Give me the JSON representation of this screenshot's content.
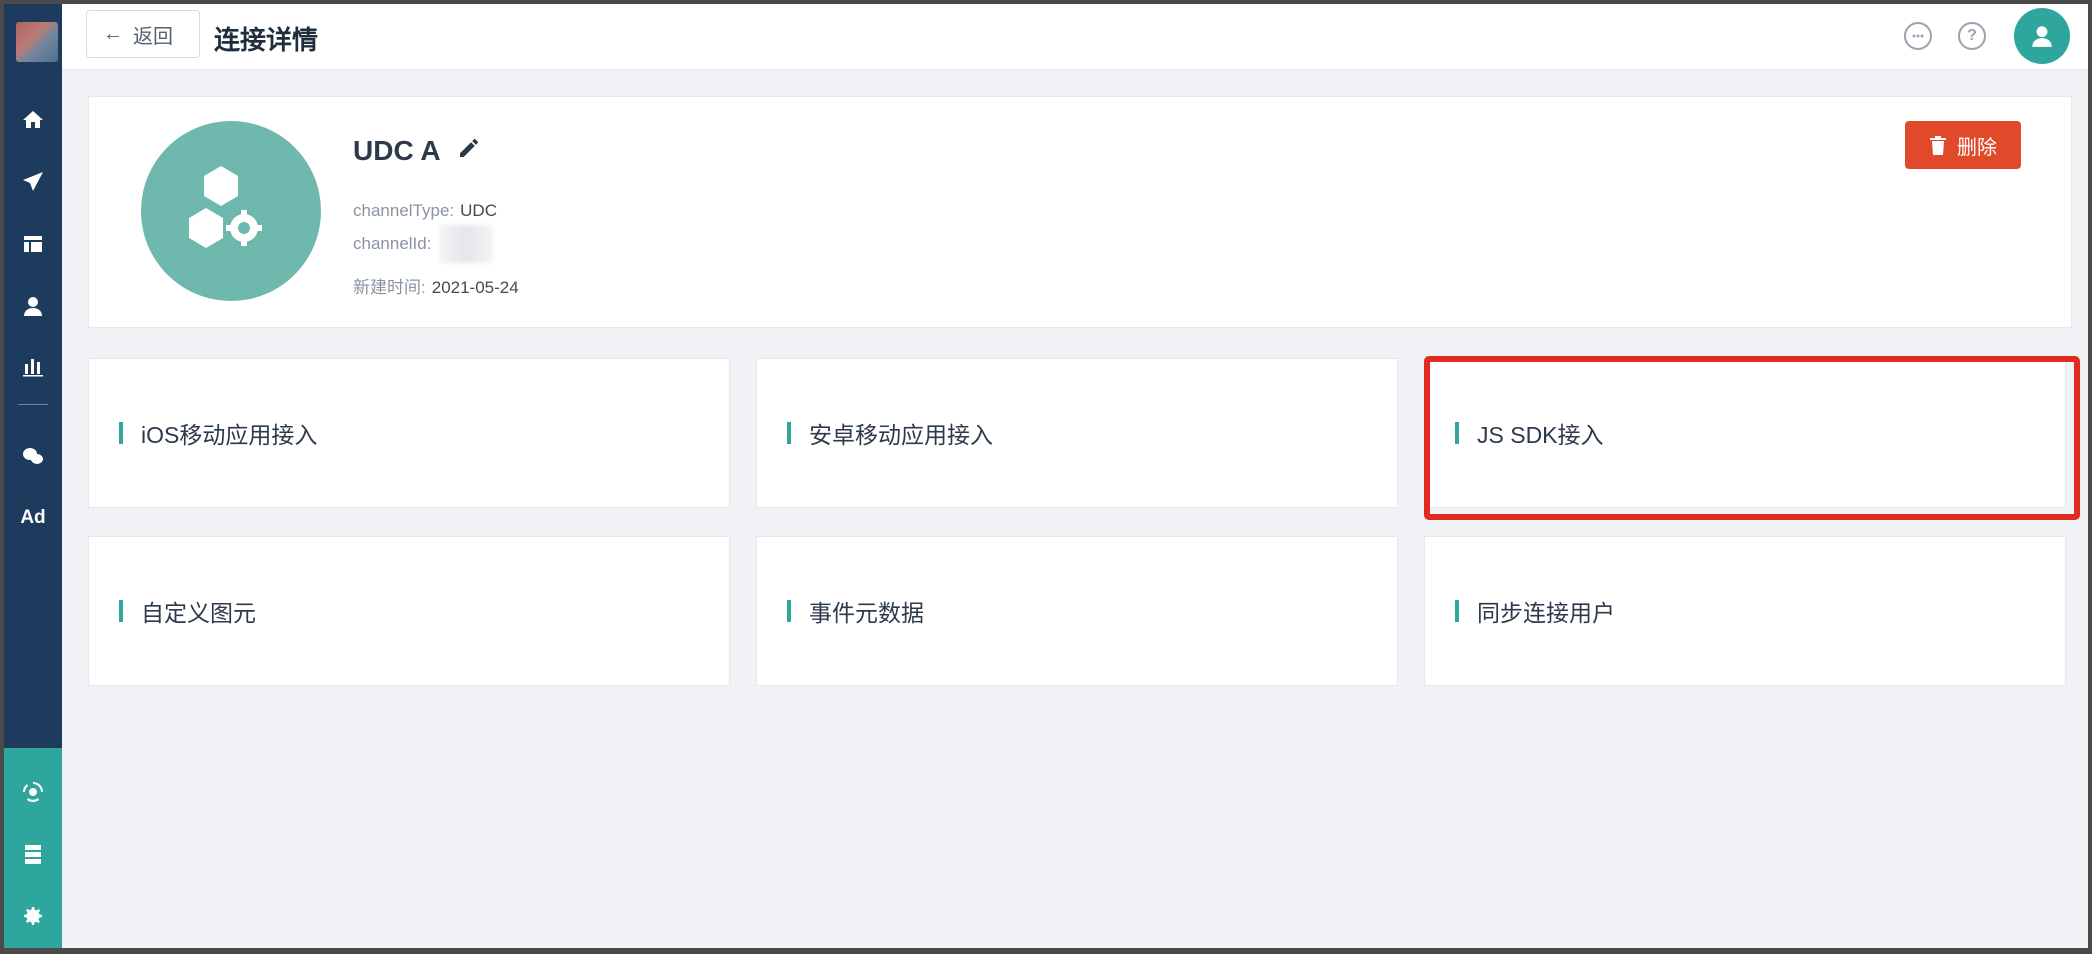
{
  "header": {
    "back_label": "返回",
    "title": "连接详情",
    "icons": [
      "chat-icon",
      "help-icon",
      "user-avatar-icon"
    ]
  },
  "sidebar": {
    "items": [
      {
        "icon": "home-icon"
      },
      {
        "icon": "send-icon"
      },
      {
        "icon": "layout-icon"
      },
      {
        "icon": "user-icon"
      },
      {
        "icon": "bar-chart-icon"
      },
      {
        "icon": "wechat-icon"
      },
      {
        "icon": "ad-icon",
        "label": "Ad"
      }
    ],
    "bottom_items": [
      {
        "icon": "connection-icon"
      },
      {
        "icon": "database-icon"
      },
      {
        "icon": "settings-icon"
      }
    ]
  },
  "channel": {
    "name": "UDC A",
    "type_label": "channelType:",
    "type_value": "UDC",
    "id_label": "channelId:",
    "created_label": "新建时间:",
    "created_value": "2021-05-24",
    "delete_label": "删除"
  },
  "tiles": [
    {
      "label": "iOS移动应用接入"
    },
    {
      "label": "安卓移动应用接入"
    },
    {
      "label": "JS SDK接入"
    },
    {
      "label": "自定义图元"
    },
    {
      "label": "事件元数据"
    },
    {
      "label": "同步连接用户"
    }
  ],
  "colors": {
    "sidebar": "#1d3b5c",
    "accent": "#2ea69d",
    "danger": "#e04a2b",
    "highlight": "#e02b20"
  }
}
